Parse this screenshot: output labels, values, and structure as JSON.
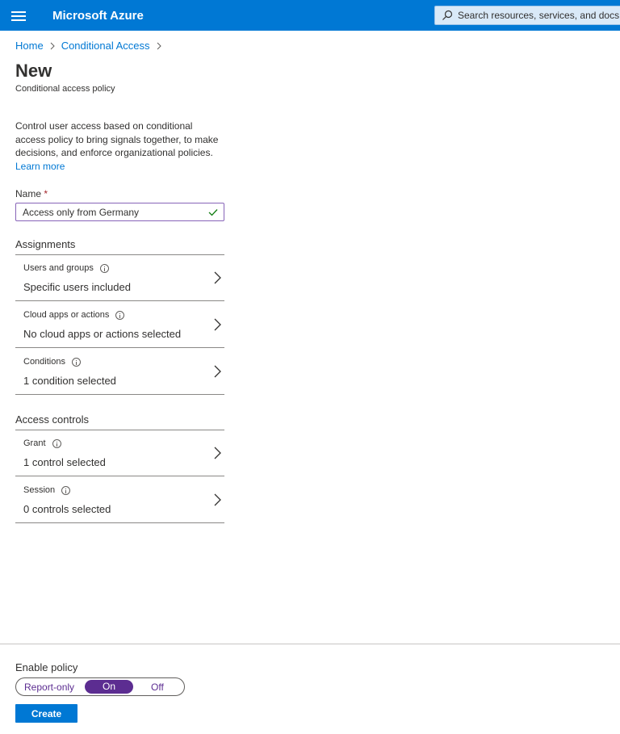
{
  "topbar": {
    "brand": "Microsoft Azure",
    "search_placeholder": "Search resources, services, and docs"
  },
  "breadcrumb": {
    "items": [
      "Home",
      "Conditional Access"
    ]
  },
  "page": {
    "title": "New",
    "subtitle": "Conditional access policy",
    "description": "Control user access based on conditional access policy to bring signals together, to make decisions, and enforce organizational policies.",
    "learn_more": "Learn more"
  },
  "name_field": {
    "label": "Name",
    "required_mark": "*",
    "value": "Access only from Germany"
  },
  "assignments": {
    "header": "Assignments",
    "rows": [
      {
        "title": "Users and groups",
        "value": "Specific users included"
      },
      {
        "title": "Cloud apps or actions",
        "value": "No cloud apps or actions selected"
      },
      {
        "title": "Conditions",
        "value": "1 condition selected"
      }
    ]
  },
  "access_controls": {
    "header": "Access controls",
    "rows": [
      {
        "title": "Grant",
        "value": "1 control selected"
      },
      {
        "title": "Session",
        "value": "0 controls selected"
      }
    ]
  },
  "footer": {
    "enable_label": "Enable policy",
    "toggle_options": [
      "Report-only",
      "On",
      "Off"
    ],
    "selected": "On",
    "create_label": "Create"
  },
  "colors": {
    "brand_blue": "#0078d4",
    "toggle_purple": "#5c2d91",
    "input_border": "#8764b8",
    "check_green": "#107c10"
  }
}
